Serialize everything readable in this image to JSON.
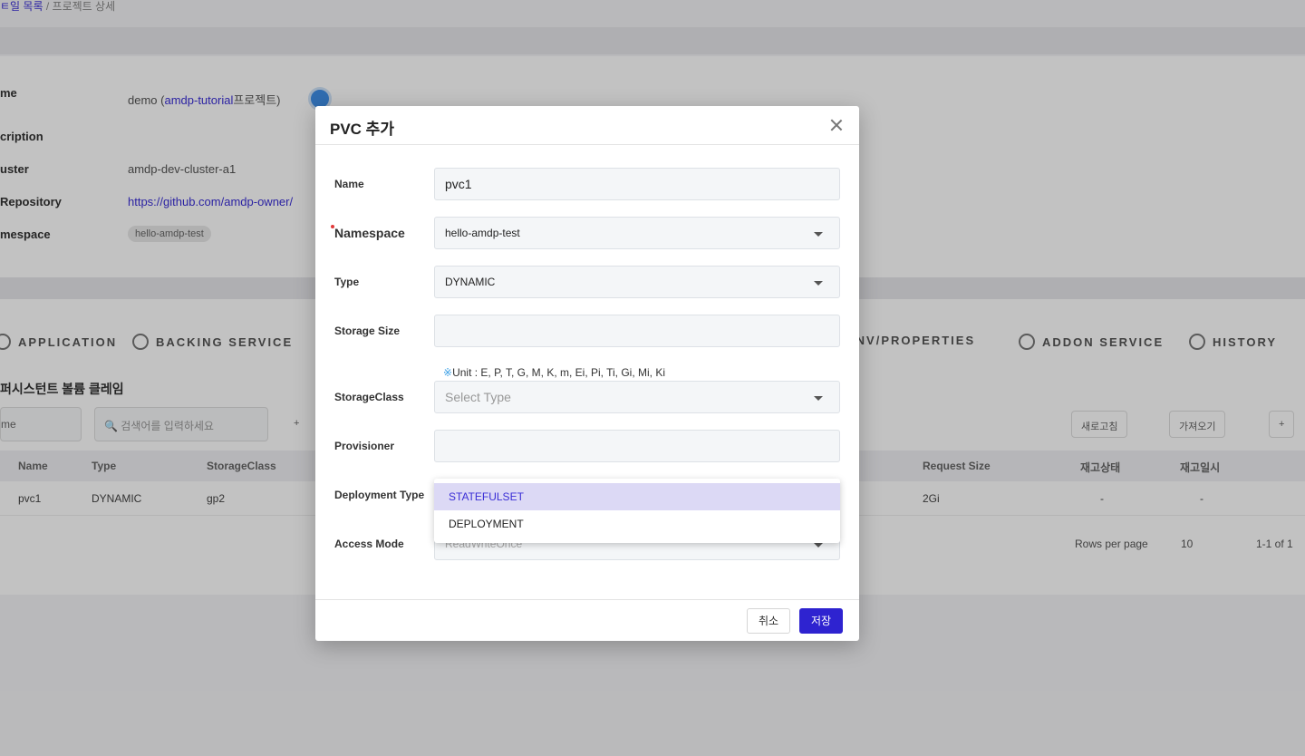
{
  "background": {
    "breadcrumb": {
      "parent": "ㅌ일 목록",
      "separator": "/",
      "current": "프로젝트 상세"
    },
    "info": {
      "rows": [
        {
          "label": "me",
          "value": "demo (",
          "link": "amdp-tutorial",
          "suffix": "프로젝트)"
        },
        {
          "label": "cription",
          "value": ""
        },
        {
          "label": "uster",
          "value": "amdp-dev-cluster-a1"
        },
        {
          "label": "Repository",
          "link": "https://github.com/amdp-owner/"
        },
        {
          "label": "mespace",
          "chip": "hello-amdp-test"
        }
      ]
    },
    "tabs": [
      "APPLICATION",
      "BACKING SERVICE",
      "ENV/PROPERTIES",
      "ADDON SERVICE",
      "HISTORY"
    ],
    "section_title": "퍼시스턴트 볼륨 클레임",
    "filter_select": "me",
    "search_placeholder": "검색어를 입력하세요",
    "add_button": "+",
    "toolbar_buttons": [
      "새로고침",
      "가져오기",
      "+"
    ],
    "table": {
      "headers": [
        "Name",
        "Type",
        "StorageClass",
        "Request Size",
        "재고상태",
        "재고일시"
      ],
      "row": [
        "pvc1",
        "DYNAMIC",
        "gp2",
        "2Gi",
        "-",
        "-"
      ]
    },
    "pager": {
      "rows_label": "Rows per page",
      "rows_value": "10",
      "range": "1-1 of 1"
    }
  },
  "modal": {
    "title": "PVC 추가",
    "fields": {
      "name": {
        "label": "Name",
        "value": "pvc1"
      },
      "namespace": {
        "label": "Namespace",
        "value": "hello-amdp-test"
      },
      "type": {
        "label": "Type",
        "value": "DYNAMIC"
      },
      "storage_size": {
        "label": "Storage Size",
        "value": ""
      },
      "unit_hint": {
        "mark": "※",
        "text": "Unit : E, P, T, G, M, K, m, Ei, Pi, Ti, Gi, Mi, Ki"
      },
      "storage_class": {
        "label": "StorageClass",
        "placeholder": "Select Type"
      },
      "provisioner": {
        "label": "Provisioner",
        "value": ""
      },
      "deployment_type": {
        "label": "Deployment Type"
      },
      "access_mode": {
        "label": "Access Mode",
        "value": "ReadWriteOnce"
      }
    },
    "dropdown_options": [
      "STATEFULSET",
      "DEPLOYMENT"
    ],
    "buttons": {
      "cancel": "취소",
      "save": "저장"
    }
  },
  "colors": {
    "primary": "#2e23d0",
    "dropdown_highlight": "#dcd9f5",
    "required": "#e23a3a"
  }
}
